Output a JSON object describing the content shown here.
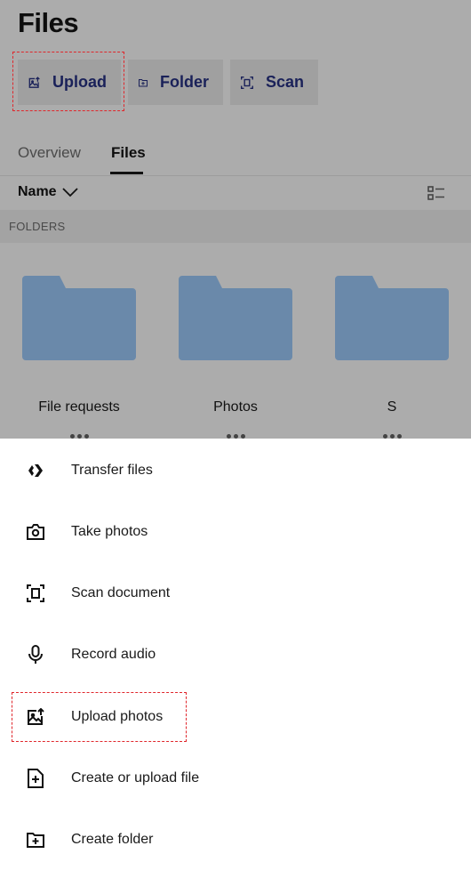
{
  "header": {
    "title": "Files"
  },
  "actions": [
    {
      "label": "Upload",
      "icon": "upload-photo-icon"
    },
    {
      "label": "Folder",
      "icon": "folder-add-icon"
    },
    {
      "label": "Scan",
      "icon": "scan-icon"
    }
  ],
  "tabs": [
    {
      "label": "Overview",
      "active": false
    },
    {
      "label": "Files",
      "active": true
    }
  ],
  "sort": {
    "label": "Name",
    "icon": "chevron-down-icon"
  },
  "view_toggle": {
    "icon": "list-view-icon"
  },
  "section": {
    "label": "FOLDERS"
  },
  "folders": [
    {
      "name": "File requests"
    },
    {
      "name": "Photos"
    },
    {
      "name": "S"
    }
  ],
  "sheet": {
    "items": [
      {
        "label": "Transfer files",
        "icon": "transfer-icon"
      },
      {
        "label": "Take photos",
        "icon": "camera-icon"
      },
      {
        "label": "Scan document",
        "icon": "scan-icon"
      },
      {
        "label": "Record audio",
        "icon": "microphone-icon"
      },
      {
        "label": "Upload photos",
        "icon": "upload-photo-icon"
      },
      {
        "label": "Create or upload file",
        "icon": "file-add-icon"
      },
      {
        "label": "Create folder",
        "icon": "folder-add-icon"
      }
    ]
  },
  "colors": {
    "overlay": "#acacac",
    "folder": "#6a89aa",
    "action_text": "#1a2159",
    "highlight": "#e0262b"
  }
}
